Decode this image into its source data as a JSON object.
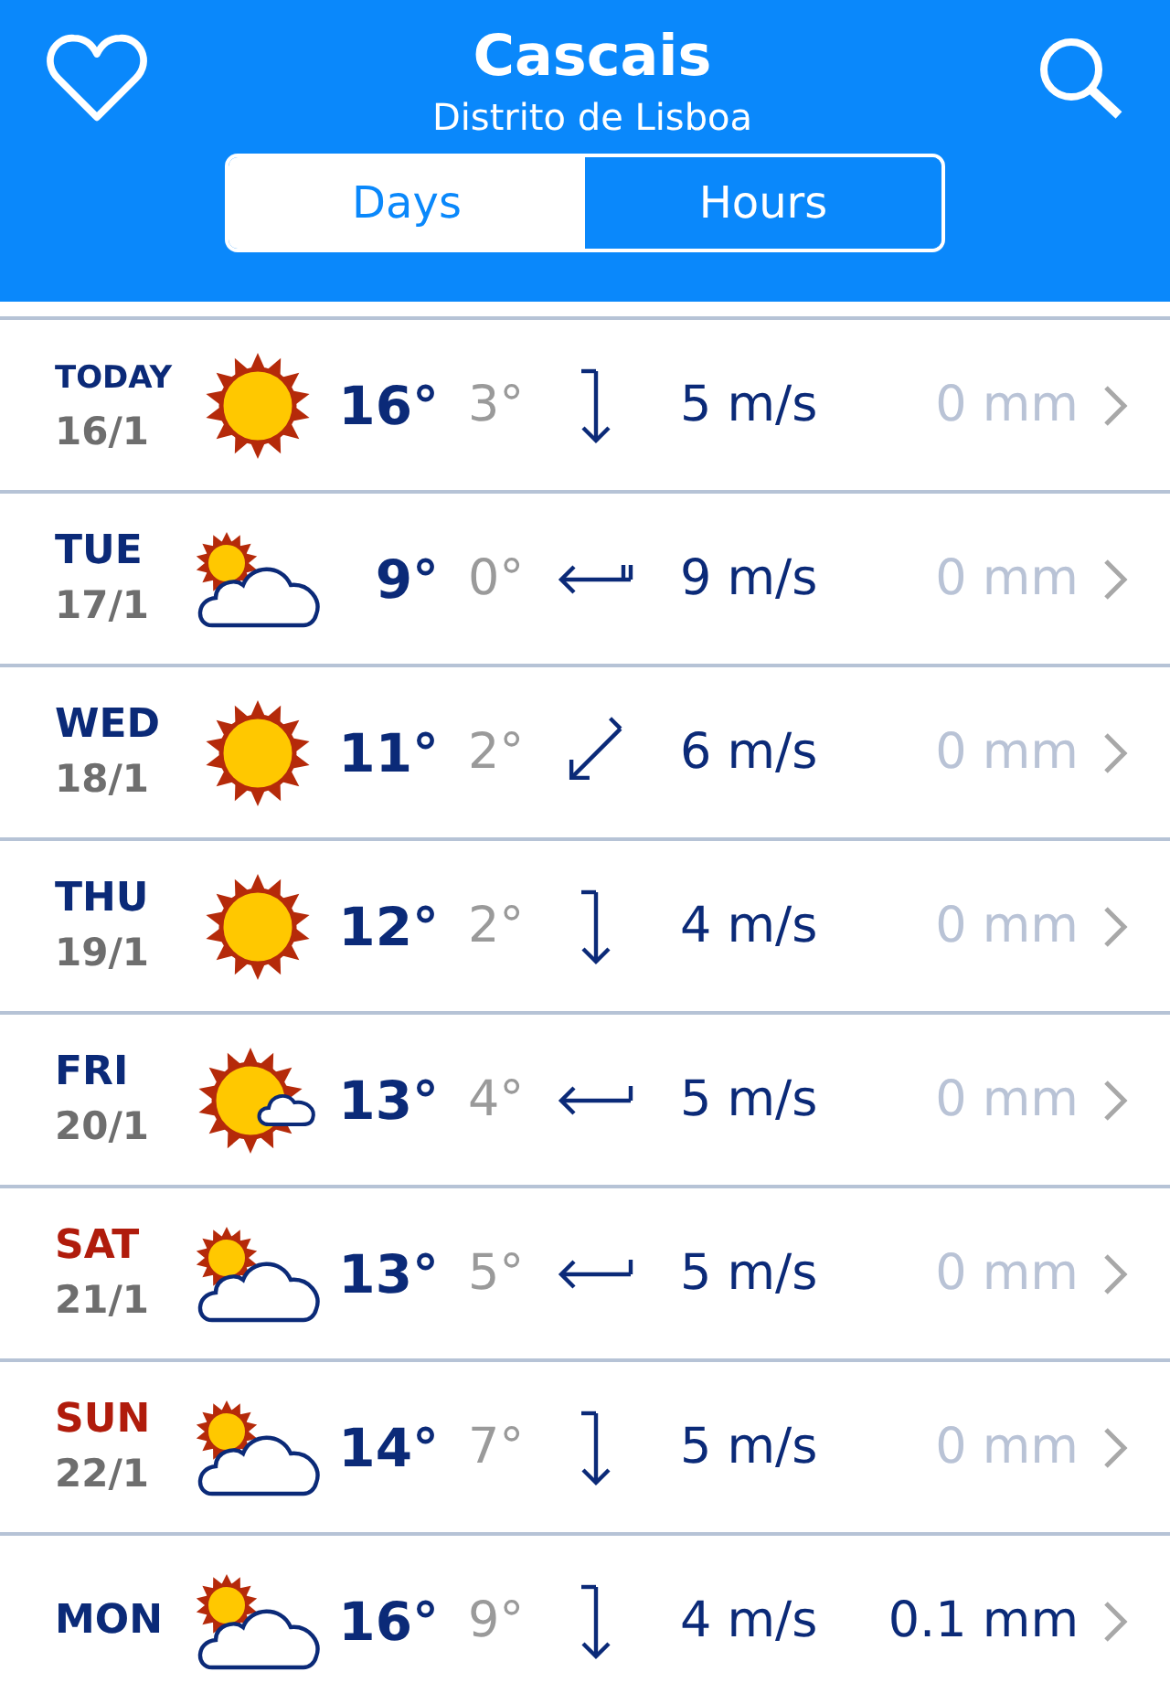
{
  "header": {
    "title": "Cascais",
    "subtitle": "Distrito de Lisboa"
  },
  "tabs": [
    {
      "label": "Days",
      "selected": true
    },
    {
      "label": "Hours",
      "selected": false
    }
  ],
  "days": [
    {
      "day": "TODAY",
      "date": "16/1",
      "weekend": false,
      "weather_icon": {
        "kind": "sunny"
      },
      "high": "16°",
      "low": "3°",
      "wind_arrow": {
        "kind": "north",
        "double_barb": false
      },
      "wind": "5 m/s",
      "precipitation": "0 mm",
      "wet": false
    },
    {
      "day": "TUE",
      "date": "17/1",
      "weekend": false,
      "weather_icon": {
        "kind": "cloudy"
      },
      "high": "9°",
      "low": "0°",
      "wind_arrow": {
        "kind": "east",
        "double_barb": true
      },
      "wind": "9 m/s",
      "precipitation": "0 mm",
      "wet": false
    },
    {
      "day": "WED",
      "date": "18/1",
      "weekend": false,
      "weather_icon": {
        "kind": "sunny"
      },
      "high": "11°",
      "low": "2°",
      "wind_arrow": {
        "kind": "northeast",
        "double_barb": false
      },
      "wind": "6 m/s",
      "precipitation": "0 mm",
      "wet": false
    },
    {
      "day": "THU",
      "date": "19/1",
      "weekend": false,
      "weather_icon": {
        "kind": "sunny"
      },
      "high": "12°",
      "low": "2°",
      "wind_arrow": {
        "kind": "north",
        "double_barb": false
      },
      "wind": "4 m/s",
      "precipitation": "0 mm",
      "wet": false
    },
    {
      "day": "FRI",
      "date": "20/1",
      "weekend": false,
      "weather_icon": {
        "kind": "fair"
      },
      "high": "13°",
      "low": "4°",
      "wind_arrow": {
        "kind": "east",
        "double_barb": false
      },
      "wind": "5 m/s",
      "precipitation": "0 mm",
      "wet": false
    },
    {
      "day": "SAT",
      "date": "21/1",
      "weekend": true,
      "weather_icon": {
        "kind": "cloudy"
      },
      "high": "13°",
      "low": "5°",
      "wind_arrow": {
        "kind": "east",
        "double_barb": false
      },
      "wind": "5 m/s",
      "precipitation": "0 mm",
      "wet": false
    },
    {
      "day": "SUN",
      "date": "22/1",
      "weekend": true,
      "weather_icon": {
        "kind": "cloudy"
      },
      "high": "14°",
      "low": "7°",
      "wind_arrow": {
        "kind": "north",
        "double_barb": false
      },
      "wind": "5 m/s",
      "precipitation": "0 mm",
      "wet": false
    },
    {
      "day": "MON",
      "weekend": false,
      "weather_icon": {
        "kind": "cloudy"
      },
      "high": "16°",
      "low": "9°",
      "wind_arrow": {
        "kind": "north",
        "double_barb": false
      },
      "wind": "4 m/s",
      "precipitation": "0.1 mm",
      "wet": true
    }
  ]
}
